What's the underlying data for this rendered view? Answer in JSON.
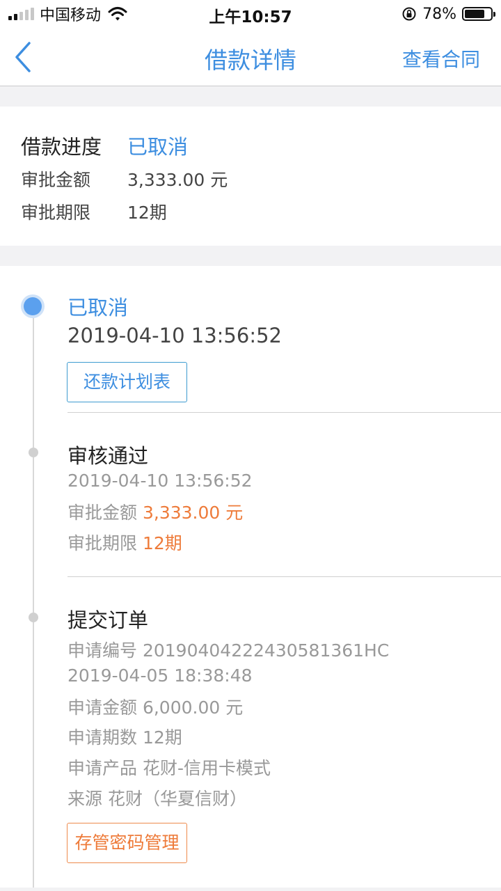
{
  "status_bar": {
    "carrier": "中国移动",
    "time": "上午10:57",
    "battery_percent": "78%",
    "battery_level": 0.78,
    "icons": [
      "signal-icon",
      "wifi-icon",
      "orientation-lock-icon",
      "battery-icon"
    ]
  },
  "nav": {
    "back_icon": "chevron-left-icon",
    "title": "借款详情",
    "right_action": "查看合同"
  },
  "summary": {
    "progress_label": "借款进度",
    "progress_value": "已取消",
    "amount_label": "审批金额",
    "amount_value": "3,333.00 元",
    "term_label": "审批期限",
    "term_value": "12期"
  },
  "timeline": {
    "cancelled": {
      "title": "已取消",
      "time": "2019-04-10 13:56:52",
      "button": "还款计划表"
    },
    "approved": {
      "title": "审核通过",
      "time": "2019-04-10 13:56:52",
      "amount_label": "审批金额",
      "amount_value": "3,333.00 元",
      "term_label": "审批期限",
      "term_value": "12期"
    },
    "submitted": {
      "title": "提交订单",
      "order_no": "申请编号 20190404222430581361HC",
      "time": "2019-04-05 18:38:48",
      "amount": "申请金额 6,000.00 元",
      "term": "申请期数 12期",
      "product": "申请产品 花财-信用卡模式",
      "source": "来源 花财（华夏信财）",
      "button": "存管密码管理"
    }
  },
  "colors": {
    "accent_blue": "#3d8ee0",
    "highlight_orange": "#ee7b3a",
    "page_background": "#f2f2f4"
  }
}
